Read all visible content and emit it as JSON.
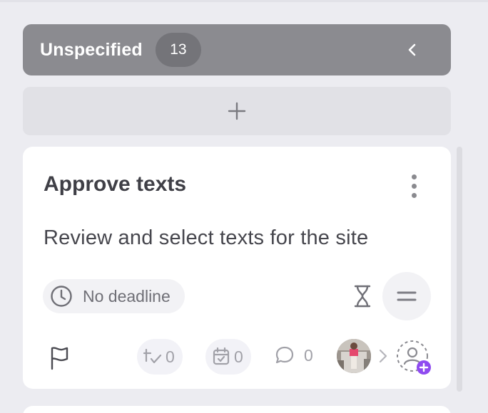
{
  "column": {
    "title": "Unspecified",
    "count": "13",
    "header_color": "#8b8b90",
    "collapse_icon": "chevron-left-icon",
    "add_icon": "plus-icon"
  },
  "card": {
    "title": "Approve texts",
    "description": "Review and select texts for the site",
    "menu_icon": "vertical-dots-icon",
    "deadline": {
      "icon": "clock-icon",
      "label": "No deadline"
    },
    "time_estimate_icon": "hourglass-icon",
    "priority_icon": "equals-icon",
    "flag_icon": "flag-icon",
    "subtasks_count": "0",
    "events_count": "0",
    "comments_count": "0",
    "assign_icon": "add-user-icon",
    "accent_color": "#8f4bf0"
  }
}
